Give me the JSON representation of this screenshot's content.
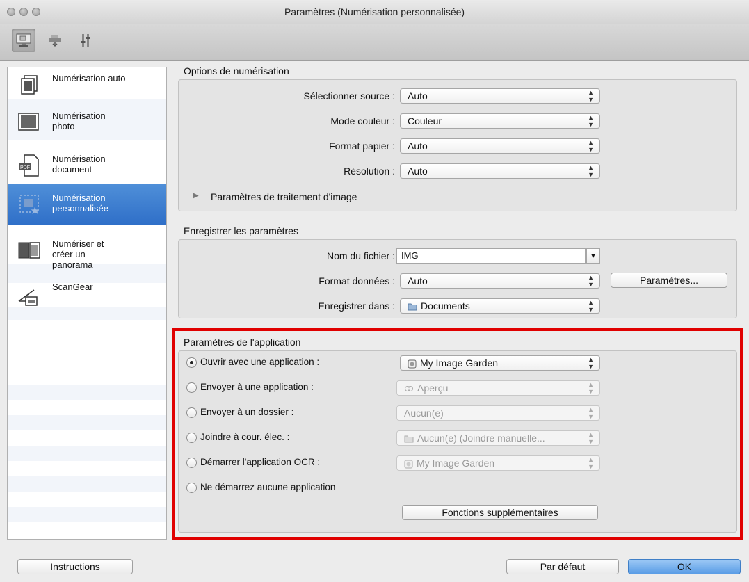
{
  "window": {
    "title": "Paramètres (Numérisation personnalisée)"
  },
  "toolbar": {
    "buttons": [
      "scan-from-computer-icon",
      "scan-from-panel-icon",
      "general-settings-icon"
    ]
  },
  "sidebar": {
    "items": [
      {
        "label": "Numérisation auto",
        "icon": "auto-scan-icon"
      },
      {
        "label": "Numérisation photo",
        "icon": "photo-scan-icon"
      },
      {
        "label": "Numérisation document",
        "icon": "document-scan-icon"
      },
      {
        "label": "Numérisation personnalisée",
        "icon": "custom-scan-icon",
        "selected": true
      },
      {
        "label": "Numériser et créer un panorama",
        "icon": "stitch-scan-icon"
      },
      {
        "label": "ScanGear",
        "icon": "scangear-icon"
      }
    ]
  },
  "scan_options": {
    "title": "Options de numérisation",
    "source": {
      "label": "Sélectionner source :",
      "value": "Auto"
    },
    "color_mode": {
      "label": "Mode couleur :",
      "value": "Couleur"
    },
    "paper_size": {
      "label": "Format papier :",
      "value": "Auto"
    },
    "resolution": {
      "label": "Résolution :",
      "value": "Auto"
    },
    "image_processing": "Paramètres de traitement d'image"
  },
  "save_settings": {
    "title": "Enregistrer les paramètres",
    "file_name": {
      "label": "Nom du fichier :",
      "value": "IMG"
    },
    "data_format": {
      "label": "Format données :",
      "value": "Auto"
    },
    "settings_button": "Paramètres...",
    "save_in": {
      "label": "Enregistrer dans :",
      "value": "Documents"
    }
  },
  "app_settings": {
    "title": "Paramètres de l'application",
    "options": [
      {
        "label": "Ouvrir avec une application :",
        "value": "My Image Garden",
        "selected": true,
        "enabled": true
      },
      {
        "label": "Envoyer à une application :",
        "value": "Aperçu",
        "selected": false,
        "enabled": false
      },
      {
        "label": "Envoyer à un dossier :",
        "value": "Aucun(e)",
        "selected": false,
        "enabled": false
      },
      {
        "label": "Joindre à cour. élec. :",
        "value": "Aucun(e) (Joindre manuelle...",
        "selected": false,
        "enabled": false
      },
      {
        "label": "Démarrer l'application OCR :",
        "value": "My Image Garden",
        "selected": false,
        "enabled": false
      },
      {
        "label": "Ne démarrez aucune application",
        "selected": false
      }
    ],
    "more_functions": "Fonctions supplémentaires"
  },
  "footer": {
    "instructions": "Instructions",
    "defaults": "Par défaut",
    "ok": "OK"
  },
  "colors": {
    "selection": "#3a7bd5",
    "highlight_border": "#e00000"
  }
}
